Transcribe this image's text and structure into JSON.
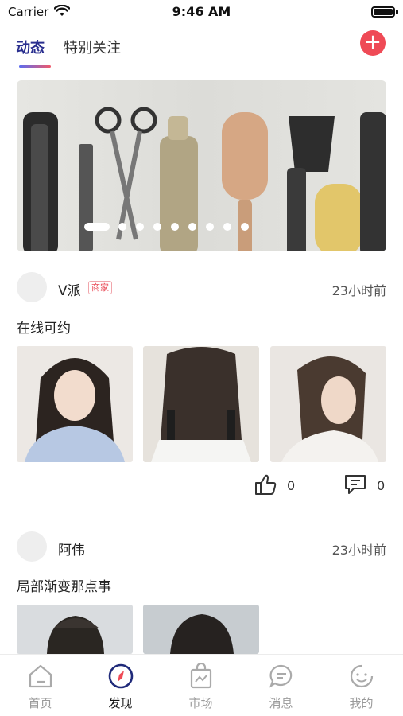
{
  "status_bar": {
    "carrier": "Carrier",
    "time": "9:46 AM"
  },
  "tabs": {
    "active": "动态",
    "follow": "特别关注"
  },
  "add_button": {
    "label": "+"
  },
  "banner": {
    "dots": 9,
    "active_dot": 0
  },
  "posts": [
    {
      "username": "V派",
      "badge": "商家",
      "time": "23小时前",
      "text": "在线可约",
      "likes": "0",
      "comments": "0"
    },
    {
      "username": "阿伟",
      "time": "23小时前",
      "text": "局部渐变那点事"
    }
  ],
  "nav": {
    "home": "首页",
    "discover": "发现",
    "market": "市场",
    "messages": "消息",
    "mine": "我的"
  },
  "colors": {
    "accent": "#ef4a56",
    "tab_active": "#2a2f8f",
    "discover_icon": "#1f2a7a"
  }
}
